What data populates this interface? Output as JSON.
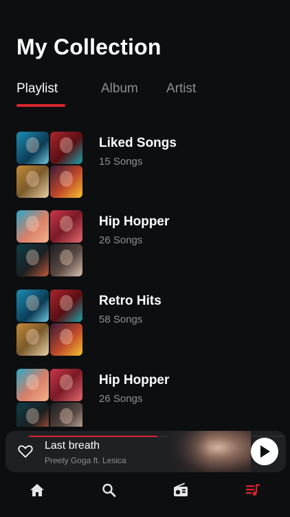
{
  "header": {
    "title": "My Collection"
  },
  "tabs": [
    {
      "label": "Playlist",
      "active": true
    },
    {
      "label": "Album",
      "active": false
    },
    {
      "label": "Artist",
      "active": false
    }
  ],
  "colors": {
    "accent": "#d9262c",
    "background": "#0d0e10",
    "card": "#1f2024",
    "muted": "#8e9094"
  },
  "playlists": [
    {
      "title": "Liked Songs",
      "subtitle": "15 Songs"
    },
    {
      "title": "Hip Hopper",
      "subtitle": "26 Songs"
    },
    {
      "title": "Retro Hits",
      "subtitle": "58 Songs"
    },
    {
      "title": "Hip Hopper",
      "subtitle": "26 Songs"
    }
  ],
  "now_playing": {
    "title": "Last breath",
    "artist": "Preety Goga ft. Lesica",
    "progress": 0.5
  },
  "nav": [
    {
      "icon": "home-icon",
      "active": false
    },
    {
      "icon": "search-icon",
      "active": false
    },
    {
      "icon": "radio-icon",
      "active": false
    },
    {
      "icon": "playlist-icon",
      "active": true
    }
  ]
}
